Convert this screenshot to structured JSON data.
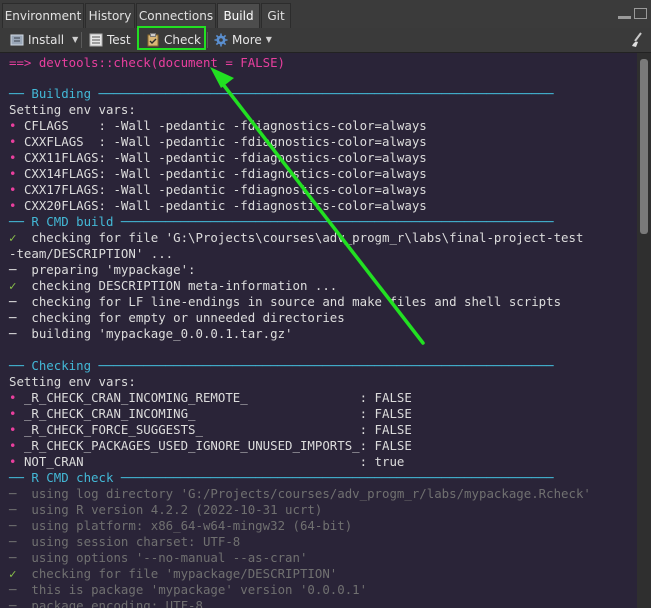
{
  "tabs": [
    "Environment",
    "History",
    "Connections",
    "Build",
    "Git"
  ],
  "toolbar": {
    "install": "Install",
    "test": "Test",
    "check": "Check",
    "more": "More"
  },
  "command": "==> devtools::check(document = FALSE)",
  "building": {
    "header": "── Building ─────────────────────────────────────────────────────────────",
    "env_title": "Setting env vars:",
    "env": [
      "CFLAGS    : -Wall -pedantic -fdiagnostics-color=always",
      "CXXFLAGS  : -Wall -pedantic -fdiagnostics-color=always",
      "CXX11FLAGS: -Wall -pedantic -fdiagnostics-color=always",
      "CXX14FLAGS: -Wall -pedantic -fdiagnostics-color=always",
      "CXX17FLAGS: -Wall -pedantic -fdiagnostics-color=always",
      "CXX20FLAGS: -Wall -pedantic -fdiagnostics-color=always"
    ],
    "build_header": "── R CMD build ──────────────────────────────────────────────────────────",
    "build_lines": [
      "checking for file 'G:\\Projects\\courses\\adv_progm_r\\labs\\final-project-test",
      "-team/DESCRIPTION' ...",
      "preparing 'mypackage':",
      "checking DESCRIPTION meta-information ...",
      "checking for LF line-endings in source and make files and shell scripts",
      "checking for empty or unneeded directories",
      "building 'mypackage_0.0.0.1.tar.gz'"
    ]
  },
  "checking": {
    "header": "── Checking ─────────────────────────────────────────────────────────────",
    "env_title": "Setting env vars:",
    "env": [
      "_R_CHECK_CRAN_INCOMING_REMOTE_               : FALSE",
      "_R_CHECK_CRAN_INCOMING_                      : FALSE",
      "_R_CHECK_FORCE_SUGGESTS_                     : FALSE",
      "_R_CHECK_PACKAGES_USED_IGNORE_UNUSED_IMPORTS_: FALSE",
      "NOT_CRAN                                     : true"
    ],
    "check_header": "── R CMD check ──────────────────────────────────────────────────────────",
    "check_lines": [
      "using log directory 'G:/Projects/courses/adv_progm_r/labs/mypackage.Rcheck'",
      "using R version 4.2.2 (2022-10-31 ucrt)",
      "using platform: x86_64-w64-mingw32 (64-bit)",
      "using session charset: UTF-8",
      "using options '--no-manual --as-cran'",
      "checking for file 'mypackage/DESCRIPTION'",
      "this is package 'mypackage' version '0.0.0.1'",
      "package encoding: UTF-8"
    ]
  },
  "colors": {
    "accent_cyan": "#43b8d6",
    "accent_pink": "#e93f9e",
    "check_green": "#8ac24a",
    "highlight_green": "#22e022"
  }
}
